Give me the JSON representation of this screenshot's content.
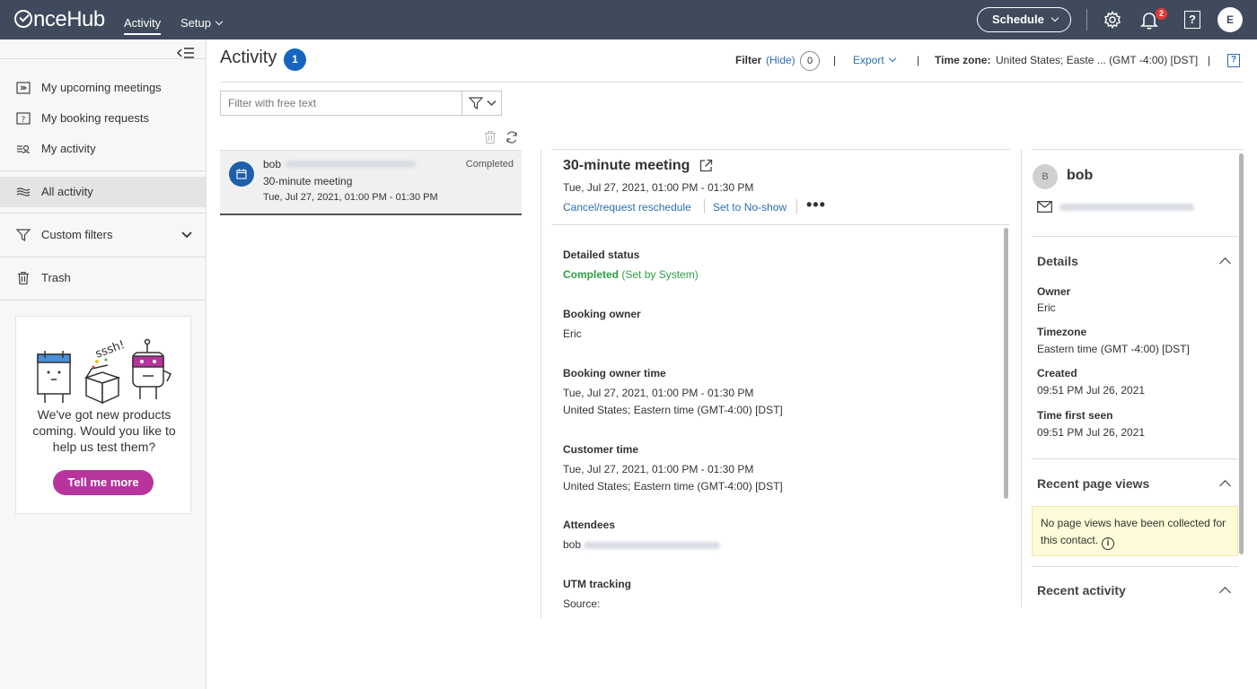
{
  "topbar": {
    "logo_text": "nceHub",
    "nav": [
      {
        "label": "Activity"
      },
      {
        "label": "Setup"
      }
    ],
    "schedule_label": "Schedule",
    "notification_count": "2",
    "help_label": "?",
    "user_initial": "E"
  },
  "sidebar": {
    "items": [
      {
        "label": "My upcoming meetings",
        "icon": "upcoming-icon"
      },
      {
        "label": "My booking requests",
        "icon": "request-icon"
      },
      {
        "label": "My activity",
        "icon": "my-activity-icon"
      },
      {
        "label": "All activity",
        "icon": "all-activity-icon"
      },
      {
        "label": "Custom filters",
        "icon": "filter-icon"
      },
      {
        "label": "Trash",
        "icon": "trash-icon"
      }
    ],
    "promo": {
      "text": "We've got new products coming. Would you like to help us test them?",
      "art_text": "sssh!",
      "button": "Tell me more"
    }
  },
  "header": {
    "title": "Activity",
    "count": "1",
    "filter_label": "Filter",
    "filter_hide": "(Hide)",
    "filter_count": "0",
    "separator": "|",
    "export_label": "Export",
    "timezone_label": "Time zone:",
    "timezone_value": "United States; Easte ... (GMT -4:00) [DST]",
    "help_label": "?"
  },
  "search": {
    "placeholder": "Filter with free text"
  },
  "list": {
    "items": [
      {
        "name": "bob",
        "status": "Completed",
        "title": "30-minute meeting",
        "time": "Tue, Jul 27, 2021, 01:00 PM - 01:30 PM"
      }
    ]
  },
  "detail": {
    "title": "30-minute meeting",
    "time": "Tue, Jul 27, 2021, 01:00 PM - 01:30 PM",
    "action_cancel": "Cancel/request reschedule",
    "action_noshow": "Set to No-show",
    "more_label": "•••",
    "detailed_status_label": "Detailed status",
    "status_value": "Completed",
    "status_note": "(Set by System)",
    "booking_owner_label": "Booking owner",
    "booking_owner_value": "Eric",
    "owner_time_label": "Booking owner time",
    "owner_time_value": "Tue, Jul 27, 2021, 01:00 PM - 01:30 PM",
    "owner_tz_value": "United States; Eastern time (GMT-4:00) [DST]",
    "customer_time_label": "Customer time",
    "customer_time_value": "Tue, Jul 27, 2021, 01:00 PM - 01:30 PM",
    "customer_tz_value": "United States; Eastern time (GMT-4:00) [DST]",
    "attendees_label": "Attendees",
    "attendee_name": "bob",
    "utm_label": "UTM tracking",
    "utm_source_label": "Source:"
  },
  "contact": {
    "initial": "B",
    "name": "bob",
    "details_heading": "Details",
    "owner_label": "Owner",
    "owner_value": "Eric",
    "timezone_label": "Timezone",
    "timezone_value": "Eastern time (GMT -4:00) [DST]",
    "created_label": "Created",
    "created_value": "09:51 PM Jul 26, 2021",
    "first_seen_label": "Time first seen",
    "first_seen_value": "09:51 PM Jul 26, 2021",
    "page_views_heading": "Recent page views",
    "page_views_note": "No page views have been collected for this contact.",
    "info_label": "i",
    "recent_activity_heading": "Recent activity"
  },
  "colors": {
    "topbar": "#3f4a5c",
    "accent_blue": "#1565c0",
    "link": "#2a6fb0",
    "completed_green": "#2e9e48",
    "promo_button": "#b7349c",
    "notification_badge": "#e53935"
  }
}
